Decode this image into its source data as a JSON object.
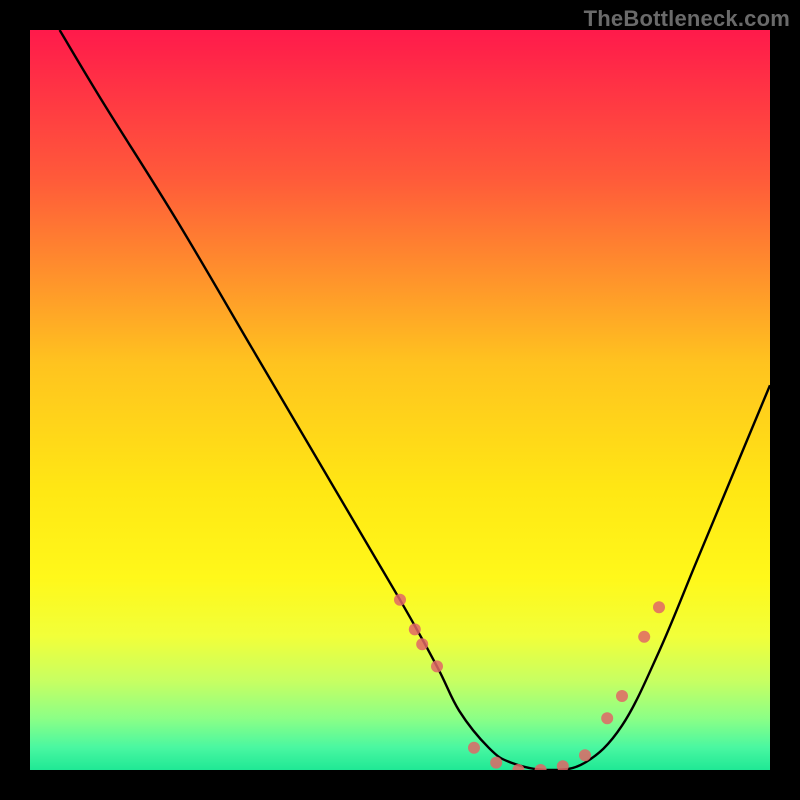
{
  "watermark": "TheBottleneck.com",
  "chart_data": {
    "type": "line",
    "title": "",
    "xlabel": "",
    "ylabel": "",
    "xlim": [
      0,
      100
    ],
    "ylim": [
      0,
      100
    ],
    "gradient_stops": [
      {
        "offset": 0.0,
        "color": "#ff1a4b"
      },
      {
        "offset": 0.2,
        "color": "#ff5a3a"
      },
      {
        "offset": 0.45,
        "color": "#ffc31f"
      },
      {
        "offset": 0.62,
        "color": "#ffe714"
      },
      {
        "offset": 0.74,
        "color": "#fff81a"
      },
      {
        "offset": 0.82,
        "color": "#f1ff3a"
      },
      {
        "offset": 0.88,
        "color": "#c7ff62"
      },
      {
        "offset": 0.93,
        "color": "#8cff86"
      },
      {
        "offset": 0.97,
        "color": "#49f7a1"
      },
      {
        "offset": 1.0,
        "color": "#1fe895"
      }
    ],
    "series": [
      {
        "name": "bottleneck-curve",
        "x": [
          4,
          10,
          20,
          30,
          40,
          50,
          55,
          58,
          62,
          65,
          70,
          75,
          80,
          85,
          90,
          95,
          100
        ],
        "y": [
          100,
          90,
          74,
          57,
          40,
          23,
          14,
          8,
          3,
          1,
          0,
          1,
          6,
          16,
          28,
          40,
          52
        ]
      }
    ],
    "markers": {
      "name": "highlight-points",
      "color": "#e06666",
      "radius": 6,
      "points": [
        {
          "x": 50,
          "y": 23
        },
        {
          "x": 52,
          "y": 19
        },
        {
          "x": 53,
          "y": 17
        },
        {
          "x": 55,
          "y": 14
        },
        {
          "x": 60,
          "y": 3
        },
        {
          "x": 63,
          "y": 1
        },
        {
          "x": 66,
          "y": 0
        },
        {
          "x": 69,
          "y": 0
        },
        {
          "x": 72,
          "y": 0.5
        },
        {
          "x": 75,
          "y": 2
        },
        {
          "x": 78,
          "y": 7
        },
        {
          "x": 80,
          "y": 10
        },
        {
          "x": 83,
          "y": 18
        },
        {
          "x": 85,
          "y": 22
        }
      ]
    }
  }
}
